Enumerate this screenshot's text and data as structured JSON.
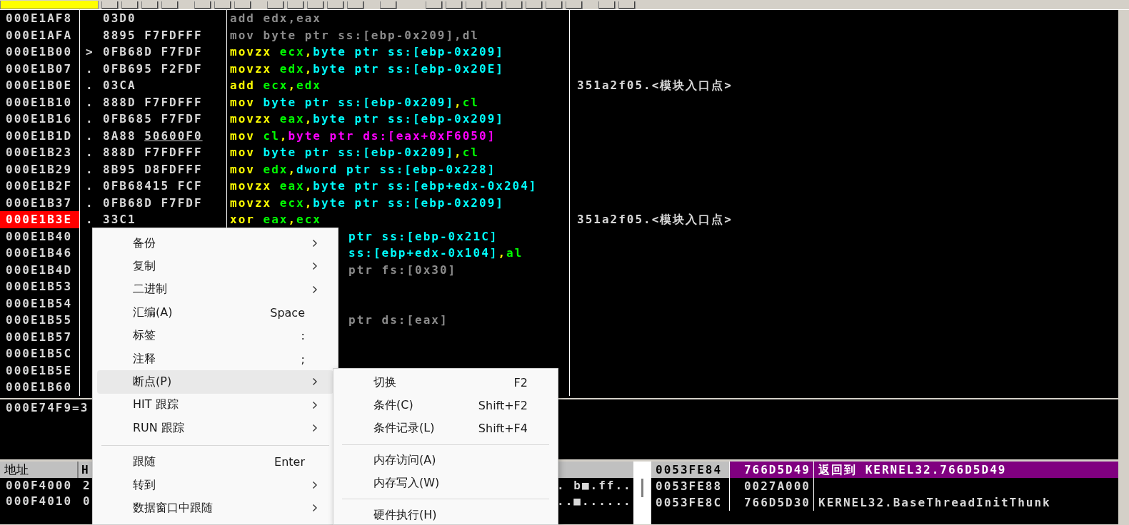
{
  "disassembly": {
    "rows": [
      {
        "address": "000E1AF8",
        "marker": "",
        "hex": "03D0",
        "breakpoint": false,
        "asm": [
          {
            "kind": "dim",
            "text": "add edx,eax"
          }
        ]
      },
      {
        "address": "000E1AFA",
        "marker": "",
        "hex": "8895 F7FDFFF",
        "breakpoint": false,
        "asm": [
          {
            "kind": "dim",
            "text": "mov byte ptr ss:[ebp-0x209],dl"
          }
        ]
      },
      {
        "address": "000E1B00",
        "marker": ">",
        "hex": "0FB68D F7FDF",
        "breakpoint": false,
        "asm": [
          {
            "kind": "op",
            "text": "movzx "
          },
          {
            "kind": "reg",
            "text": "ecx"
          },
          {
            "kind": "op",
            "text": ","
          },
          {
            "kind": "mem",
            "text": "byte ptr ss:[ebp-0x209]"
          }
        ]
      },
      {
        "address": "000E1B07",
        "marker": ".",
        "hex": "0FB695 F2FDF",
        "breakpoint": false,
        "asm": [
          {
            "kind": "op",
            "text": "movzx "
          },
          {
            "kind": "reg",
            "text": "edx"
          },
          {
            "kind": "op",
            "text": ","
          },
          {
            "kind": "mem",
            "text": "byte ptr ss:[ebp-0x20E]"
          }
        ]
      },
      {
        "address": "000E1B0E",
        "marker": ".",
        "hex": "03CA",
        "breakpoint": false,
        "asm": [
          {
            "kind": "op",
            "text": "add "
          },
          {
            "kind": "reg",
            "text": "ecx"
          },
          {
            "kind": "op",
            "text": ","
          },
          {
            "kind": "reg",
            "text": "edx"
          }
        ],
        "comment": "351a2f05.<模块入口点>"
      },
      {
        "address": "000E1B10",
        "marker": ".",
        "hex": "888D F7FDFFF",
        "breakpoint": false,
        "asm": [
          {
            "kind": "op",
            "text": "mov "
          },
          {
            "kind": "mem",
            "text": "byte ptr ss:[ebp-0x209]"
          },
          {
            "kind": "op",
            "text": ","
          },
          {
            "kind": "reg",
            "text": "cl"
          }
        ]
      },
      {
        "address": "000E1B16",
        "marker": ".",
        "hex": "0FB685 F7FDF",
        "breakpoint": false,
        "asm": [
          {
            "kind": "op",
            "text": "movzx "
          },
          {
            "kind": "reg",
            "text": "eax"
          },
          {
            "kind": "op",
            "text": ","
          },
          {
            "kind": "mem",
            "text": "byte ptr ss:[ebp-0x209]"
          }
        ]
      },
      {
        "address": "000E1B1D",
        "marker": ".",
        "hex": "8A88",
        "hex_ref": "50600F0",
        "breakpoint": false,
        "asm": [
          {
            "kind": "op",
            "text": "mov "
          },
          {
            "kind": "reg",
            "text": "cl"
          },
          {
            "kind": "op",
            "text": ","
          },
          {
            "kind": "ref",
            "text": "byte ptr ds:[eax+0xF6050]"
          }
        ]
      },
      {
        "address": "000E1B23",
        "marker": ".",
        "hex": "888D F7FDFFF",
        "breakpoint": false,
        "asm": [
          {
            "kind": "op",
            "text": "mov "
          },
          {
            "kind": "mem",
            "text": "byte ptr ss:[ebp-0x209]"
          },
          {
            "kind": "op",
            "text": ","
          },
          {
            "kind": "reg",
            "text": "cl"
          }
        ]
      },
      {
        "address": "000E1B29",
        "marker": ".",
        "hex": "8B95 D8FDFFF",
        "breakpoint": false,
        "asm": [
          {
            "kind": "op",
            "text": "mov "
          },
          {
            "kind": "reg",
            "text": "edx"
          },
          {
            "kind": "op",
            "text": ","
          },
          {
            "kind": "mem",
            "text": "dword ptr ss:[ebp-0x228]"
          }
        ]
      },
      {
        "address": "000E1B2F",
        "marker": ".",
        "hex": "0FB68415 FCF",
        "breakpoint": false,
        "asm": [
          {
            "kind": "op",
            "text": "movzx "
          },
          {
            "kind": "reg",
            "text": "eax"
          },
          {
            "kind": "op",
            "text": ","
          },
          {
            "kind": "mem",
            "text": "byte ptr ss:[ebp+edx-0x204]"
          }
        ]
      },
      {
        "address": "000E1B37",
        "marker": ".",
        "hex": "0FB68D F7FDF",
        "breakpoint": false,
        "asm": [
          {
            "kind": "op",
            "text": "movzx "
          },
          {
            "kind": "reg",
            "text": "ecx"
          },
          {
            "kind": "op",
            "text": ","
          },
          {
            "kind": "mem",
            "text": "byte ptr ss:[ebp-0x209]"
          }
        ]
      },
      {
        "address": "000E1B3E",
        "marker": ".",
        "hex": "33C1",
        "breakpoint": true,
        "asm": [
          {
            "kind": "op",
            "text": "xor "
          },
          {
            "kind": "reg",
            "text": "eax"
          },
          {
            "kind": "op",
            "text": ","
          },
          {
            "kind": "reg",
            "text": "ecx"
          }
        ],
        "comment": "351a2f05.<模块入口点>"
      },
      {
        "address": "000E1B40",
        "breakpoint": false,
        "asm": [
          {
            "kind": "mem",
            "text": "ptr ss:[ebp-0x21C]"
          }
        ]
      },
      {
        "address": "000E1B46",
        "breakpoint": false,
        "asm": [
          {
            "kind": "mem",
            "text": "ss:[ebp+edx-0x104]"
          },
          {
            "kind": "op",
            "text": ","
          },
          {
            "kind": "reg",
            "text": "al"
          }
        ]
      },
      {
        "address": "000E1B4D",
        "breakpoint": false,
        "asm": [
          {
            "kind": "dim",
            "text": "ptr fs:[0x30]"
          }
        ]
      },
      {
        "address": "000E1B53",
        "breakpoint": false
      },
      {
        "address": "000E1B54",
        "breakpoint": false
      },
      {
        "address": "000E1B55",
        "breakpoint": false,
        "asm": [
          {
            "kind": "dim",
            "text": "ptr ds:[eax]"
          }
        ]
      },
      {
        "address": "000E1B57",
        "breakpoint": false
      },
      {
        "address": "000E1B5C",
        "breakpoint": false
      },
      {
        "address": "000E1B5E",
        "breakpoint": false
      },
      {
        "address": "000E1B60",
        "breakpoint": false
      }
    ]
  },
  "info": {
    "text": "000E74F9=3"
  },
  "dump": {
    "columns": [
      "地址",
      "H"
    ],
    "rows": [
      {
        "address": "000F4000",
        "hex": "2",
        "ascii": ". b■.ff.."
      },
      {
        "address": "000F4010",
        "hex": "0",
        "ascii": "..■......"
      }
    ]
  },
  "stack": {
    "rows": [
      {
        "address": "0053FE84",
        "value": "766D5D49",
        "comment": "返回到 KERNEL32.766D5D49",
        "selected": true
      },
      {
        "address": "0053FE88",
        "value": "0027A000",
        "selected": false
      },
      {
        "address": "0053FE8C",
        "value": "766D5D30",
        "comment": "KERNEL32.BaseThreadInitThunk",
        "selected": false
      }
    ]
  },
  "context_menu": {
    "items": [
      {
        "kind": "item",
        "label": "备份",
        "has_submenu": true,
        "selected": false
      },
      {
        "kind": "item",
        "label": "复制",
        "has_submenu": true,
        "selected": false
      },
      {
        "kind": "item",
        "label": "二进制",
        "has_submenu": true,
        "selected": false
      },
      {
        "kind": "item",
        "label": "汇编(A)",
        "shortcut": "Space",
        "has_submenu": false,
        "selected": false
      },
      {
        "kind": "item",
        "label": "标签",
        "shortcut": ":",
        "has_submenu": false,
        "selected": false
      },
      {
        "kind": "item",
        "label": "注释",
        "shortcut": ";",
        "has_submenu": false,
        "selected": false
      },
      {
        "kind": "item",
        "label": "断点(P)",
        "has_submenu": true,
        "selected": true
      },
      {
        "kind": "item",
        "label": "HIT 跟踪",
        "has_submenu": true,
        "selected": false
      },
      {
        "kind": "item",
        "label": "RUN 跟踪",
        "has_submenu": true,
        "selected": false
      },
      {
        "kind": "separator"
      },
      {
        "kind": "item",
        "label": "跟随",
        "shortcut": "Enter",
        "has_submenu": false,
        "selected": false
      },
      {
        "kind": "item",
        "label": "转到",
        "has_submenu": true,
        "selected": false
      },
      {
        "kind": "item",
        "label": "数据窗口中跟随",
        "has_submenu": true,
        "selected": false
      }
    ]
  },
  "submenu": {
    "items": [
      {
        "kind": "item",
        "label": "切换",
        "shortcut": "F2",
        "selected": false
      },
      {
        "kind": "item",
        "label": "条件(C)",
        "shortcut": "Shift+F2",
        "selected": false
      },
      {
        "kind": "item",
        "label": "条件记录(L)",
        "shortcut": "Shift+F4",
        "selected": false
      },
      {
        "kind": "separator"
      },
      {
        "kind": "item",
        "label": "内存访问(A)",
        "selected": false
      },
      {
        "kind": "item",
        "label": "内存写入(W)",
        "selected": false
      },
      {
        "kind": "separator"
      },
      {
        "kind": "item",
        "label": "硬件执行(H)",
        "selected": false
      }
    ]
  }
}
